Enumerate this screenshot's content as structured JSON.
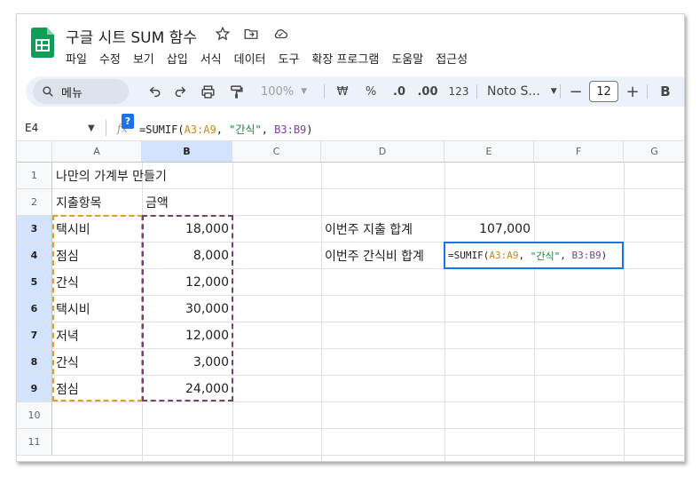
{
  "title_bar": {
    "doc_title": "구글 시트 SUM 함수",
    "icons": [
      "star-icon",
      "move-folder-icon",
      "cloud-icon"
    ]
  },
  "menu": [
    "파일",
    "수정",
    "보기",
    "삽입",
    "서식",
    "데이터",
    "도구",
    "확장 프로그램",
    "도움말",
    "접근성"
  ],
  "toolbar": {
    "search_label": "메뉴",
    "zoom": "100%",
    "currency": "₩",
    "percent": "%",
    "dec_decrease": ".0",
    "dec_increase": ".00",
    "number_format": "123",
    "font_name": "Noto S...",
    "font_size": "12",
    "minus": "−",
    "plus": "+",
    "bold": "B"
  },
  "formula_bar": {
    "cell_ref": "E4",
    "help": "?",
    "formula_prefix": "=SUMIF(",
    "formula_arg1": "A3:A9",
    "formula_sep1": ", ",
    "formula_arg2": "\"간식\"",
    "formula_sep2": ", ",
    "formula_arg3": "B3:B9",
    "formula_suffix": ")"
  },
  "columns": [
    "A",
    "B",
    "C",
    "D",
    "E",
    "F",
    "G"
  ],
  "rows": [
    "1",
    "2",
    "3",
    "4",
    "5",
    "6",
    "7",
    "8",
    "9",
    "10",
    "11"
  ],
  "cells": {
    "A1": "나만의 가계부 만들기",
    "A2": "지출항목",
    "B2": "금액",
    "items": [
      {
        "name": "택시비",
        "amount": "18,000"
      },
      {
        "name": "점심",
        "amount": "8,000"
      },
      {
        "name": "간식",
        "amount": "12,000"
      },
      {
        "name": "택시비",
        "amount": "30,000"
      },
      {
        "name": "저녁",
        "amount": "12,000"
      },
      {
        "name": "간식",
        "amount": "3,000"
      },
      {
        "name": "점심",
        "amount": "24,000"
      }
    ],
    "D3": "이번주 지출 합계",
    "E3": "107,000",
    "D4": "이번주 간식비 합계"
  },
  "colors": {
    "range_a": "#e69a2b",
    "range_b": "#7b3f6e",
    "active": "#1a73e8",
    "selected_header": "#d3e3fd"
  }
}
